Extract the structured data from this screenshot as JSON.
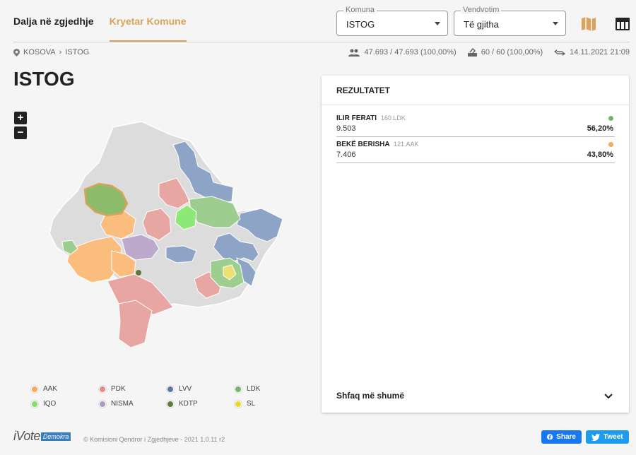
{
  "header": {
    "tabs": [
      {
        "label": "Dalja në zgjedhje",
        "active": false
      },
      {
        "label": "Kryetar Komune",
        "active": true
      }
    ],
    "komuna": {
      "legend": "Komuna",
      "value": "ISTOG"
    },
    "vendvotim": {
      "legend": "Vendvotim",
      "value": "Të gjitha"
    },
    "icons": [
      "map-icon",
      "table-icon"
    ],
    "accent_color": "#d9a35c"
  },
  "breadcrumb": {
    "root": "KOSOVA",
    "current": "ISTOG"
  },
  "stats": {
    "voters": "47.693 / 47.693 (100,00%)",
    "stations": "60 / 60 (100,00%)",
    "updated": "14.11.2021 21:09"
  },
  "page_title": "ISTOG",
  "zoom": {
    "in": "+",
    "out": "−"
  },
  "legend": [
    {
      "label": "AAK",
      "color": "#f5a95a"
    },
    {
      "label": "PDK",
      "color": "#e08a86"
    },
    {
      "label": "LVV",
      "color": "#5d77a8"
    },
    {
      "label": "LDK",
      "color": "#74b66a"
    },
    {
      "label": "IQO",
      "color": "#7ee06a"
    },
    {
      "label": "NISMA",
      "color": "#ad99bf"
    },
    {
      "label": "KDTP",
      "color": "#5d7a3a"
    },
    {
      "label": "SL",
      "color": "#e8d62a"
    }
  ],
  "results": {
    "title": "REZULTATET",
    "candidates": [
      {
        "name": "ILIR FERATI",
        "party": "160.LDK",
        "votes": "9.503",
        "percent": "56,20%",
        "color": "#74b66a"
      },
      {
        "name": "BEKË BERISHA",
        "party": "121.AAK",
        "votes": "7.406",
        "percent": "43,80%",
        "color": "#f5a95a"
      }
    ],
    "more_label": "Shfaq më shumë"
  },
  "footer": {
    "brand": "iVote",
    "brand_tag": "Demokra",
    "copyright": "© Komisioni Qendror i Zgjedhjeve - 2021 1.0.11 r2",
    "share_label": "Share",
    "tweet_label": "Tweet"
  }
}
